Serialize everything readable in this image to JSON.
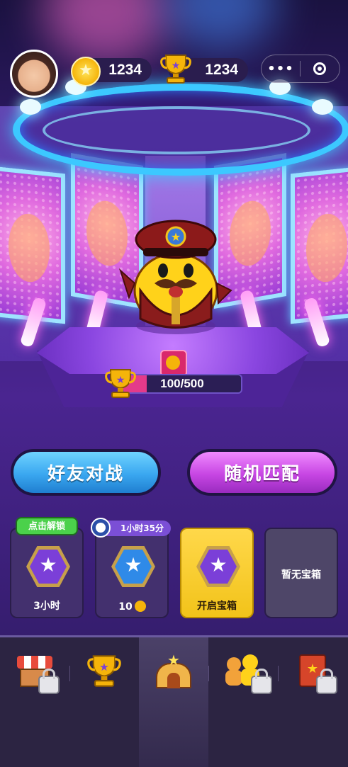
{
  "header": {
    "coins": "1234",
    "trophies": "1234",
    "icons": {
      "coin": "coin-icon",
      "trophy": "trophy-icon",
      "more": "more-dots-icon",
      "target": "target-icon"
    }
  },
  "stage": {
    "mascot": "mustache-duck-conductor",
    "trophy_progress": {
      "text": "100/500",
      "value": 100,
      "max": 500,
      "badge_icon": "coin-ribbon-icon"
    }
  },
  "actions": {
    "friends_battle": "好友对战",
    "random_match": "随机匹配"
  },
  "chests": [
    {
      "tooltip": "点击解锁",
      "label": "3小时",
      "icon": "winged-star-chest-icon"
    },
    {
      "timer": "1小时35分",
      "label": "10",
      "icon": "blue-star-chest-icon"
    },
    {
      "label": "开启宝箱",
      "icon": "winged-star-chest-icon"
    },
    {
      "label": "暂无宝箱"
    }
  ],
  "nav": [
    {
      "name": "shop",
      "icon": "shop-stall-icon",
      "locked": true
    },
    {
      "name": "trophy",
      "icon": "trophy-icon",
      "locked": false
    },
    {
      "name": "home",
      "icon": "home-arena-icon",
      "locked": false,
      "active": true
    },
    {
      "name": "friends",
      "icon": "friends-icon",
      "locked": true
    },
    {
      "name": "book",
      "icon": "card-book-icon",
      "locked": true
    }
  ],
  "colors": {
    "blue_button": "#3aa7f0",
    "pink_button": "#c746e3",
    "gold_chest": "#f2c31a",
    "progress_fill": "#e43a8a",
    "stage_ring": "#3cc8ff"
  }
}
